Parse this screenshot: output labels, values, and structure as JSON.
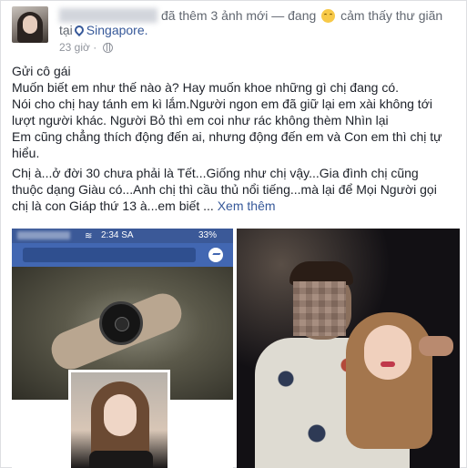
{
  "post": {
    "author_prefix": "đã thêm 3 ảnh mới — đang",
    "feeling": "cảm thấy thư giãn",
    "location_prefix": "tại",
    "location": "Singapore.",
    "time": "23 giờ ·",
    "lines": [
      "Gửi cô gái",
      "Muốn biết em như thế nào à? Hay muốn khoe những gì chị đang có.",
      "Nói cho chị hay tánh em kì lắm.Người ngon em đã giữ lại em xài không tới",
      "lượt người khác. Người Bỏ thì em coi như rác không thèm Nhìn lại",
      "Em cũng chẳng thích động đến ai, nhưng động đến em và Con em thì chị tự",
      "hiểu.",
      "Chị à...ở đời 30 chưa phải là Tết...Giống như chị vậy...Gia đình chị cũng",
      "thuộc dạng Giàu có...Anh chị thì cầu thủ nổi tiếng...mà lại để Mọi Người gọi",
      "chị là con Giáp thứ 13 à...em biết ..."
    ],
    "see_more": "Xem thêm"
  },
  "phone": {
    "time": "2:34 SA",
    "battery": "33%",
    "wifi": "≋"
  },
  "icons": {
    "location": "map-pin-icon",
    "privacy": "globe-icon",
    "feeling": "relieved-emoji-icon",
    "messenger": "messenger-icon"
  },
  "colors": {
    "link": "#365899",
    "facebook_blue": "#4267b2"
  }
}
